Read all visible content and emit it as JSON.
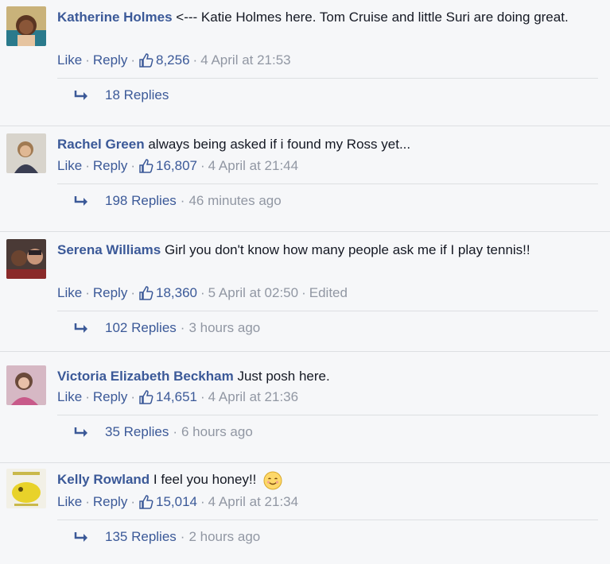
{
  "comments": [
    {
      "author": "Katherine Holmes",
      "text": "<--- Katie Holmes here. Tom Cruise and little Suri are doing great.",
      "like": "Like",
      "reply": "Reply",
      "likes_count": "8,256",
      "time": "4 April at 21:53",
      "replies": "18 Replies"
    },
    {
      "author": "Rachel Green",
      "text": "always being asked if i found my Ross yet...",
      "like": "Like",
      "reply": "Reply",
      "likes_count": "16,807",
      "time": "4 April at 21:44",
      "replies": "198 Replies",
      "replies_time": "46 minutes ago"
    },
    {
      "author": "Serena Williams",
      "text": "Girl you don't know how many people ask me if I play tennis!!",
      "like": "Like",
      "reply": "Reply",
      "likes_count": "18,360",
      "time": "5 April at 02:50",
      "edited": "Edited",
      "replies": "102 Replies",
      "replies_time": "3 hours ago"
    },
    {
      "author": "Victoria Elizabeth Beckham",
      "text": "Just posh here.",
      "like": "Like",
      "reply": "Reply",
      "likes_count": "14,651",
      "time": "4 April at 21:36",
      "replies": "35 Replies",
      "replies_time": "6 hours ago"
    },
    {
      "author": "Kelly Rowland",
      "text": "I feel you honey!!",
      "like": "Like",
      "reply": "Reply",
      "likes_count": "15,014",
      "time": "4 April at 21:34",
      "replies": "135 Replies",
      "replies_time": "2 hours ago",
      "emoji": "smiling-face-emoji"
    }
  ],
  "colors": {
    "link": "#3b5998",
    "muted": "#9197a3",
    "background": "#f6f7f9",
    "divider": "#dddfe2"
  }
}
